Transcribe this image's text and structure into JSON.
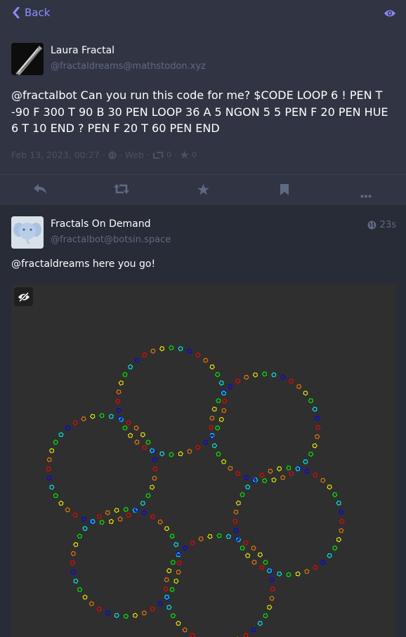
{
  "topbar": {
    "back_label": "Back",
    "back_icon": "chevron-left-icon",
    "toggle_icon": "eye-icon"
  },
  "post": {
    "display_name": "Laura Fractal",
    "acct": "@fractaldreams@mathstodon.xyz",
    "content": "@fractalbot Can you run this code for me? $CODE LOOP 6 ! PEN T -90 F 300 T 90 B 30 PEN LOOP 36 A 5 NGON 5 5 PEN F 20 PEN HUE 6 T 10 END ? PEN F 20 T 60 PEN END",
    "date": "Feb 13, 2023, 00:27",
    "sep1": "·",
    "sep2": "·",
    "sep3": "·",
    "sep4": "·",
    "app": "Web",
    "reblogs": "0",
    "favourites": "0"
  },
  "actions": [
    "reply-icon",
    "boost-icon",
    "star-icon",
    "bookmark-icon",
    "more-icon"
  ],
  "reply": {
    "display_name": "Fractals On Demand",
    "acct": "@fractalbot@botsin.space",
    "time": "23s",
    "content": "@fractaldreams here you go!"
  },
  "colors": {
    "accent": "#8c8dff",
    "bg": "#282c37",
    "panel": "#313543",
    "muted": "#606984"
  },
  "drawing": {
    "circles": 6,
    "pentagons_per_circle": 36,
    "hues": [
      "#ff0000",
      "#ff8000",
      "#ffff00",
      "#00ff00",
      "#00ffff",
      "#0000ff"
    ]
  }
}
